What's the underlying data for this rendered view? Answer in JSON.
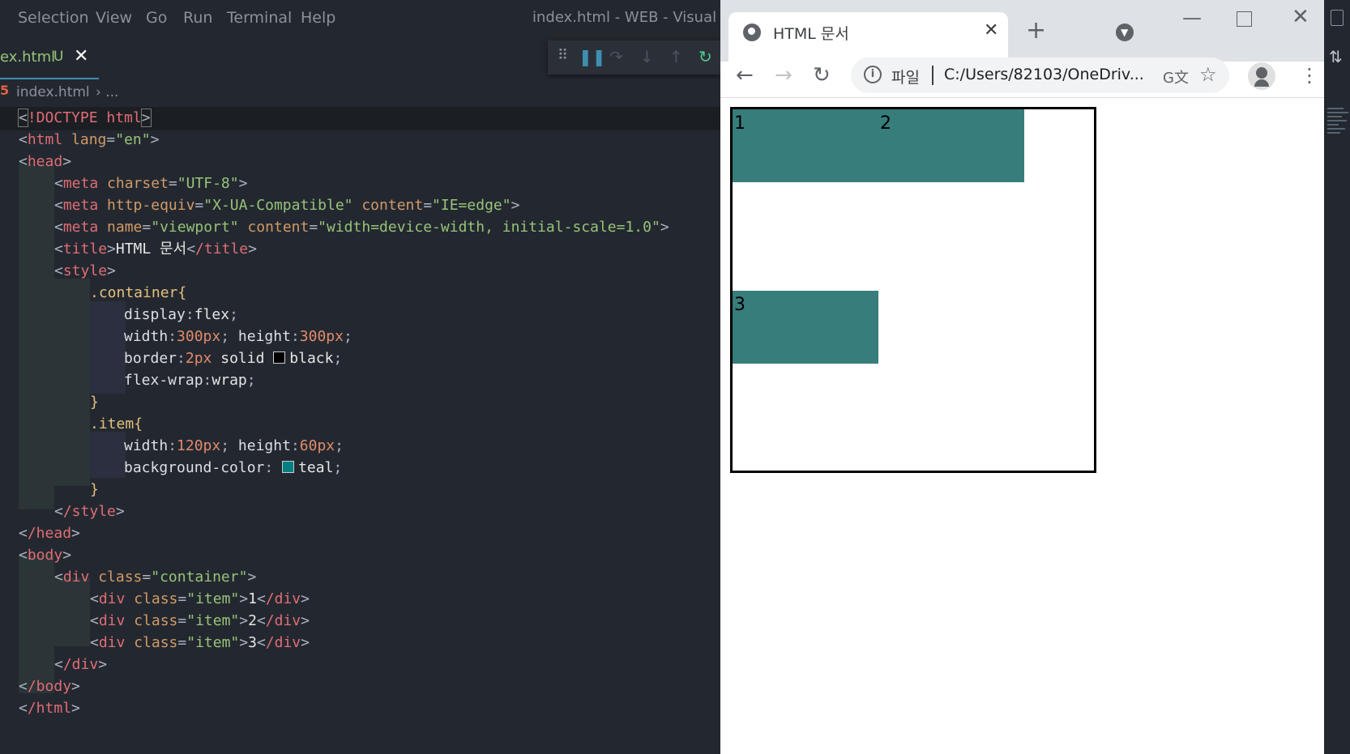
{
  "vscode": {
    "menu": [
      "Selection",
      "View",
      "Go",
      "Run",
      "Terminal",
      "Help"
    ],
    "window_title": "index.html - WEB - Visual Stu",
    "tab": {
      "label": "ex.html",
      "status": "U",
      "close": "✕"
    },
    "breadcrumb": {
      "icon": "html5-icon",
      "file": "index.html",
      "rest": "› ..."
    },
    "code": {
      "l1": {
        "a": "<",
        "b": "!DOCTYPE",
        "c": " html",
        "d": ">"
      },
      "l2": {
        "tag": "html",
        "attr": "lang",
        "val": "\"en\""
      },
      "l3": {
        "tag": "head"
      },
      "l4": {
        "tag": "meta",
        "attr": "charset",
        "val": "\"UTF-8\""
      },
      "l5": {
        "tag": "meta",
        "attr1": "http-equiv",
        "val1": "\"X-UA-Compatible\"",
        "attr2": "content",
        "val2": "\"IE=edge\""
      },
      "l6": {
        "tag": "meta",
        "attr1": "name",
        "val1": "\"viewport\"",
        "attr2": "content",
        "val2": "\"width=device-width, initial-scale=1.0\""
      },
      "l7": {
        "tag": "title",
        "text": "HTML 문서",
        "close": "/title"
      },
      "l8": {
        "tag": "style"
      },
      "l9": {
        "selector": ".container",
        "brace": "{"
      },
      "l10": {
        "prop": "display",
        "val": "flex"
      },
      "l11": {
        "prop1": "width",
        "num1": "300px",
        "prop2": "height",
        "num2": "300px"
      },
      "l12": {
        "prop": "border",
        "num": "2px",
        "kw": "solid",
        "color": "black"
      },
      "l13": {
        "prop": "flex-wrap",
        "val": "wrap"
      },
      "l14": {
        "brace": "}"
      },
      "l15": {
        "selector": ".item",
        "brace": "{"
      },
      "l16": {
        "prop1": "width",
        "num1": "120px",
        "prop2": "height",
        "num2": "60px"
      },
      "l17": {
        "prop": "background-color",
        "color": "teal"
      },
      "l18": {
        "brace": "}"
      },
      "l19": {
        "close": "/style"
      },
      "l20": {
        "close": "/head"
      },
      "l21": {
        "tag": "body"
      },
      "l22": {
        "tag": "div",
        "attr": "class",
        "val": "\"container\""
      },
      "l23": {
        "tag": "div",
        "attr": "class",
        "val": "\"item\"",
        "text": "1",
        "close": "/div"
      },
      "l24": {
        "tag": "div",
        "attr": "class",
        "val": "\"item\"",
        "text": "2",
        "close": "/div"
      },
      "l25": {
        "tag": "div",
        "attr": "class",
        "val": "\"item\"",
        "text": "3",
        "close": "/div"
      },
      "l26": {
        "close": "/div"
      },
      "l27": {
        "close": "/body"
      },
      "l28": {
        "close": "/html"
      }
    }
  },
  "chrome": {
    "tab_title": "HTML 문서",
    "tab_close": "✕",
    "new_tab": "+",
    "omnibox": {
      "scheme_label": "파일",
      "url": "C:/Users/82103/OneDriv...",
      "info": "i"
    },
    "page": {
      "items": [
        "1",
        "2",
        "3"
      ],
      "item_color": "#367d7b",
      "border_color": "#000000"
    }
  },
  "colors": {
    "editor_bg": "#232830",
    "accent": "#3e8fb0",
    "teal": "#008080"
  }
}
